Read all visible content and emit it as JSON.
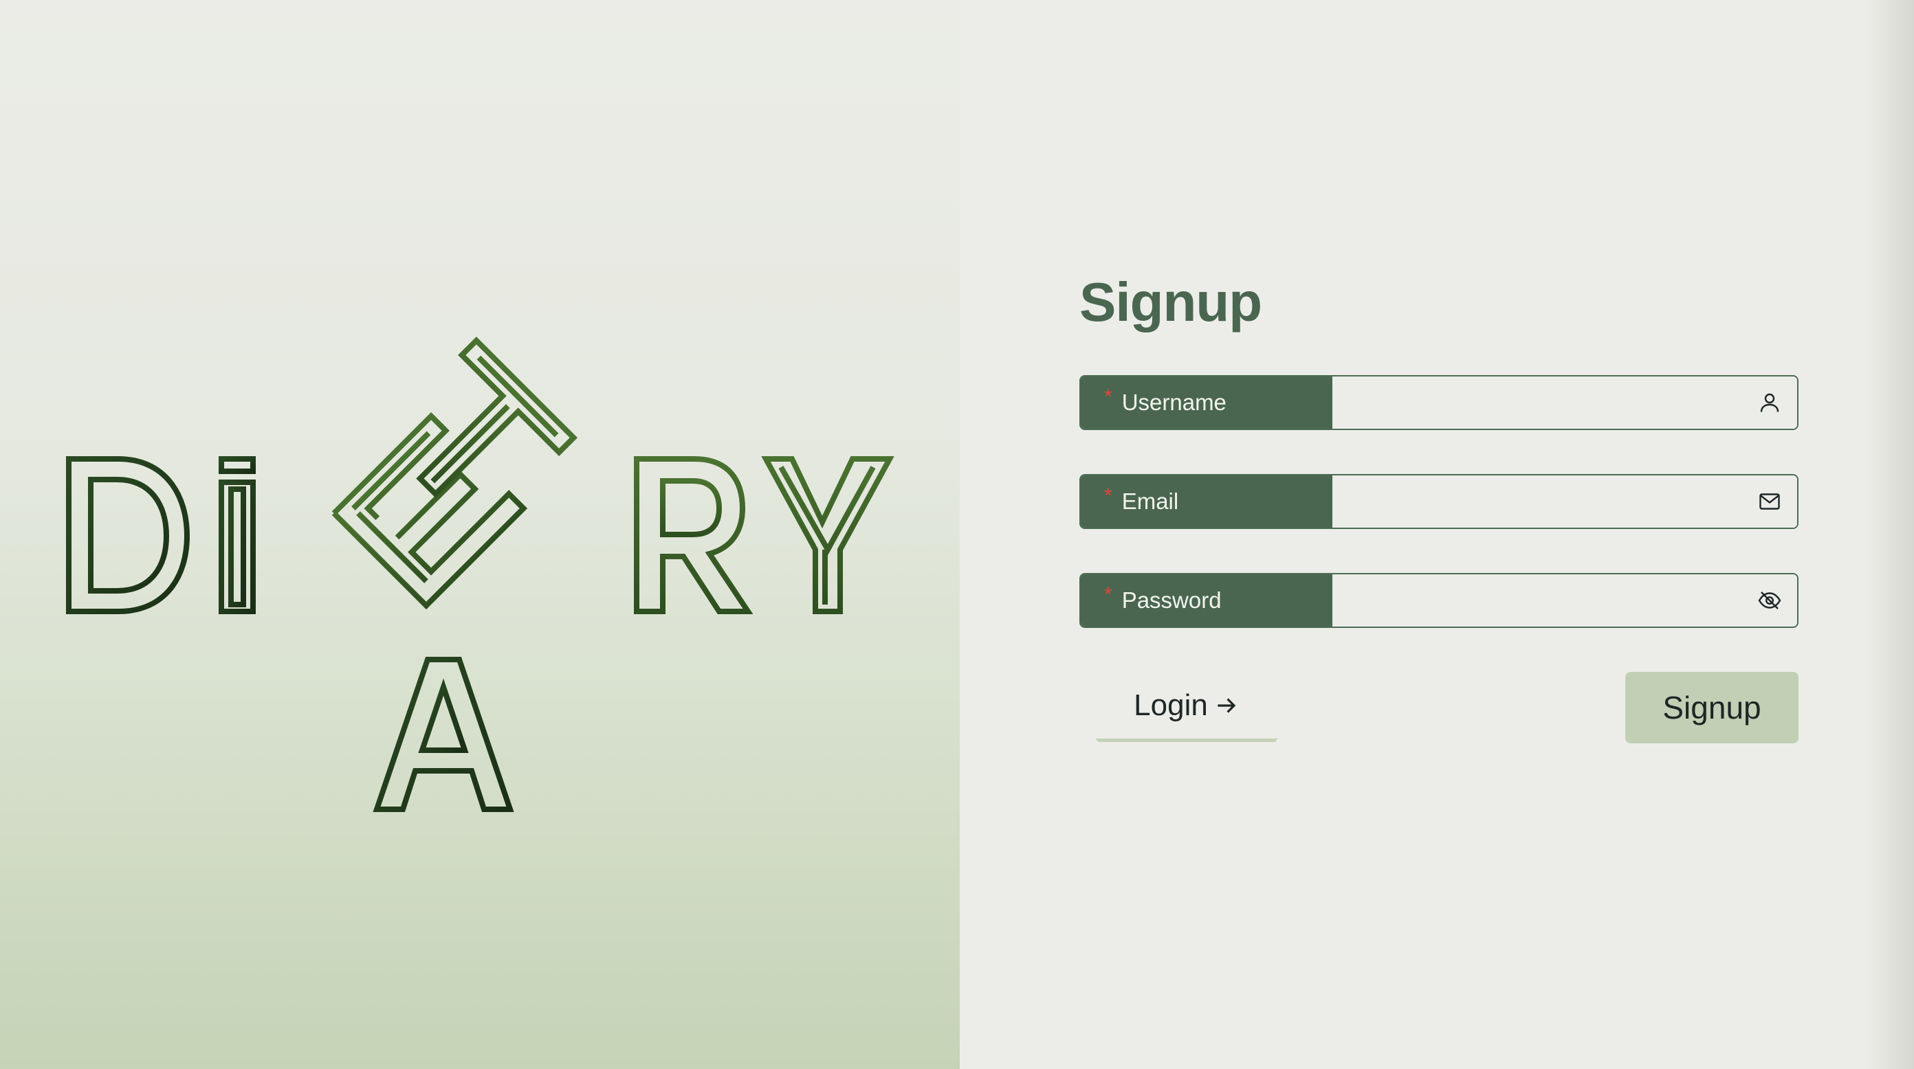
{
  "brand": {
    "logo_text": "DIETARY",
    "logo_color_dark": "#1f3a1a",
    "logo_color_light": "#44662c"
  },
  "form": {
    "title": "Signup",
    "fields": [
      {
        "label": "Username",
        "required_mark": "*",
        "value": "",
        "icon": "user-icon"
      },
      {
        "label": "Email",
        "required_mark": "*",
        "value": "",
        "icon": "mail-icon"
      },
      {
        "label": "Password",
        "required_mark": "*",
        "value": "",
        "icon": "eye-off-icon"
      }
    ],
    "login_label": "Login",
    "submit_label": "Signup"
  },
  "colors": {
    "primary": "#4a6650",
    "accent": "#c1d0b4",
    "required": "#e0453a",
    "background": "#ecede8"
  }
}
